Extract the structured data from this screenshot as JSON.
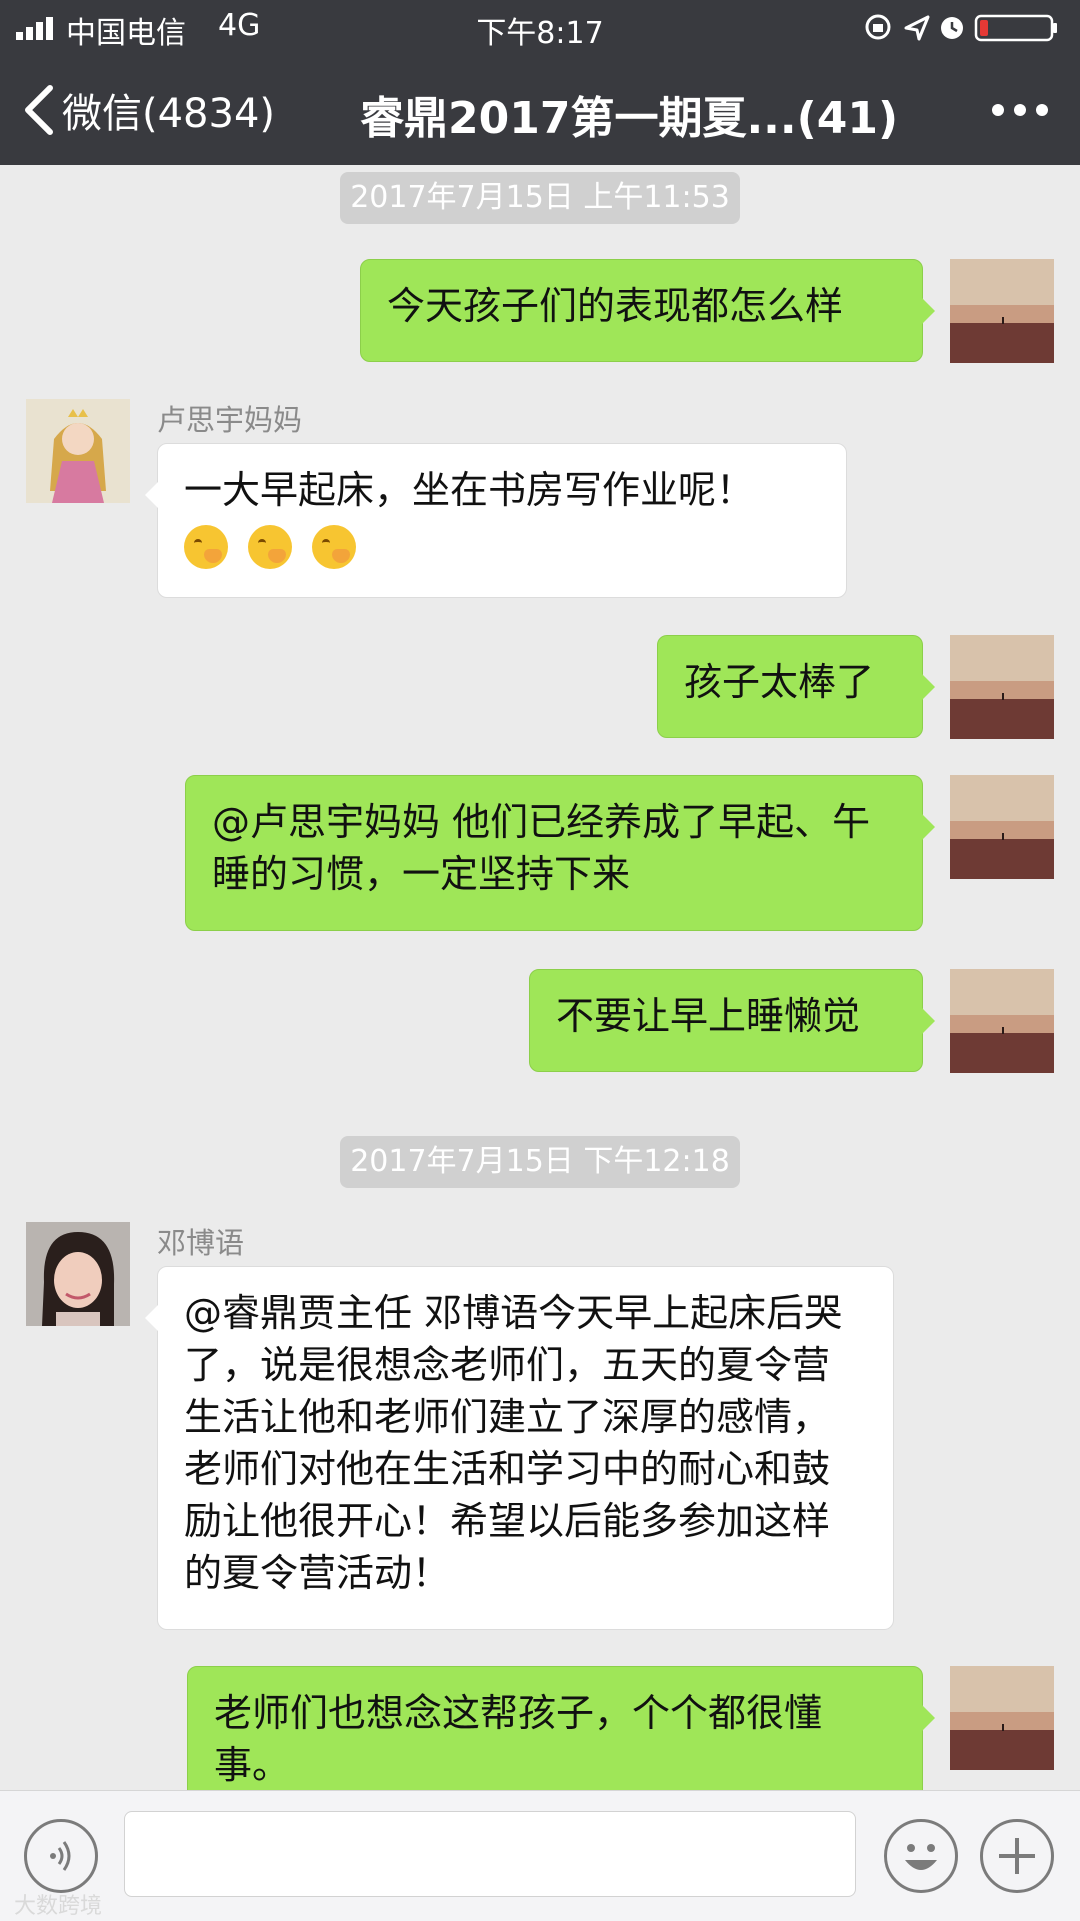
{
  "status_bar": {
    "carrier": "中国电信",
    "network": "4G",
    "time": "下午8:17"
  },
  "nav": {
    "back_label": "微信(4834)",
    "title": "睿鼎2017第一期夏...(41)"
  },
  "messages": {
    "ts1": "2017年7月15日 上午11:53",
    "m1": "今天孩子们的表现都怎么样",
    "sender1": "卢思宇妈妈",
    "m2": "一大早起床，坐在书房写作业呢！",
    "m3": "孩子太棒了",
    "m4": "@卢思宇妈妈 他们已经养成了早起、午睡的习惯，一定坚持下来",
    "m5": "不要让早上睡懒觉",
    "ts2": "2017年7月15日 下午12:18",
    "sender2": "邓博语",
    "m6": "@睿鼎贾主任 邓博语今天早上起床后哭了，说是很想念老师们，五天的夏令营生活让他和老师们建立了深厚的感情，老师们对他在生活和学习中的耐心和鼓励让他很开心！希望以后能多参加这样的夏令营活动！",
    "m7": "老师们也想念这帮孩子，个个都很懂事。"
  },
  "icons": {
    "signal": "signal-icon",
    "battery": "battery-icon",
    "back": "chevron-left-icon",
    "more": "more-icon",
    "voice": "voice-icon",
    "emoji": "emoji-icon",
    "plus": "plus-icon"
  },
  "watermark": "大数跨境",
  "colors": {
    "nav_bg": "#393a3f",
    "chat_bg": "#ebebeb",
    "outgoing_bubble": "#9fe658",
    "incoming_bubble": "#ffffff",
    "battery_low": "#e53935"
  }
}
